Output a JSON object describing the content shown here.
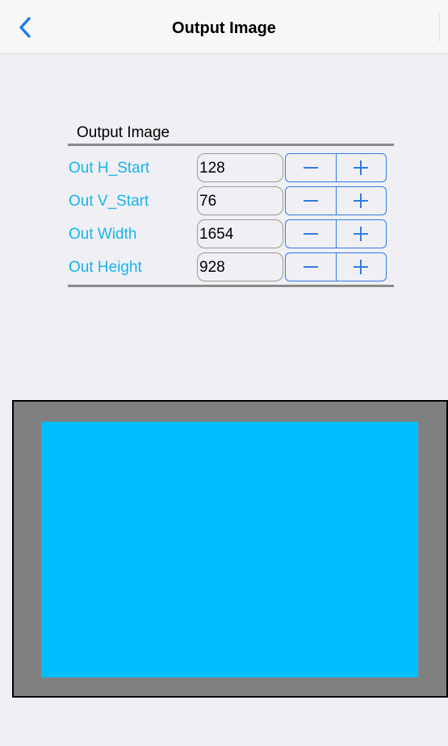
{
  "navbar": {
    "title": "Output Image",
    "back_icon": "chevron-left-icon",
    "accent_color": "#1e7cf0"
  },
  "group": {
    "title": "Output Image",
    "label_color": "#18b4e8",
    "rows": [
      {
        "label": "Out H_Start",
        "value": "128"
      },
      {
        "label": "Out V_Start",
        "value": "76"
      },
      {
        "label": "Out Width",
        "value": "1654"
      },
      {
        "label": "Out Height",
        "value": "928"
      }
    ],
    "stepper_icons": [
      "minus-icon",
      "plus-icon"
    ]
  },
  "preview": {
    "frame_color": "#808080",
    "output_color": "#00bfff"
  }
}
